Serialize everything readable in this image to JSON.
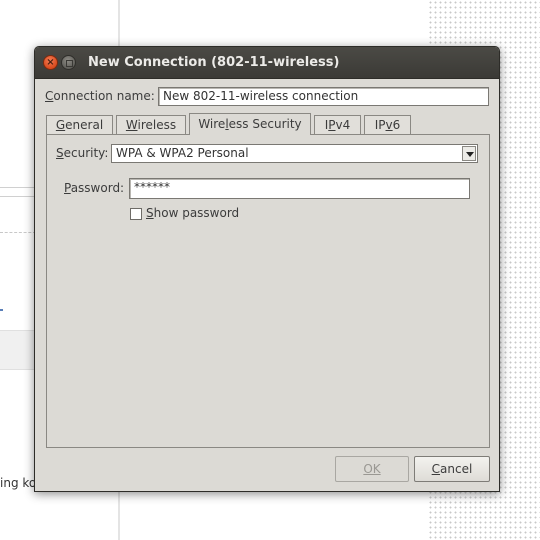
{
  "background": {
    "partial_text": "ing ko"
  },
  "dialog": {
    "title": "New Connection (802-11-wireless)",
    "connection_name_label": "Connection name:",
    "connection_name_value": "New 802-11-wireless connection",
    "tabs": [
      {
        "label": "General",
        "active": false
      },
      {
        "label": "Wireless",
        "active": false
      },
      {
        "label": "Wireless Security",
        "active": true
      },
      {
        "label": "IPv4",
        "active": false
      },
      {
        "label": "IPv6",
        "active": false
      }
    ],
    "security_label": "Security:",
    "security_value": "WPA & WPA2 Personal",
    "password_label": "Password:",
    "password_value": "******",
    "show_password_label": "Show password",
    "show_password_checked": false,
    "ok_label": "OK",
    "ok_enabled": false,
    "cancel_label": "Cancel"
  }
}
